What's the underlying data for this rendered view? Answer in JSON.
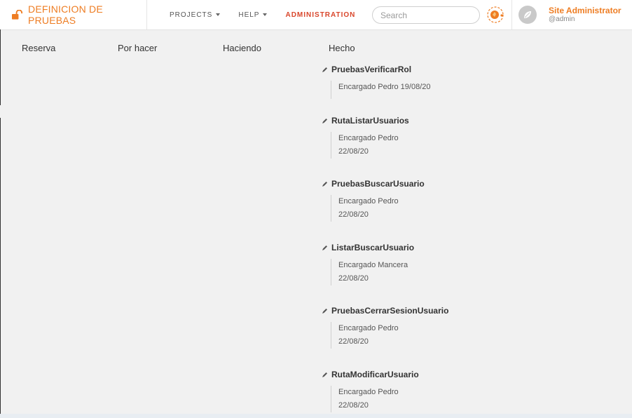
{
  "header": {
    "brand": "DEFINICION DE PRUEBAS",
    "nav": {
      "projects": "PROJECTS",
      "help": "HELP",
      "administration": "ADMINISTRATION"
    },
    "search_placeholder": "Search",
    "user": {
      "name": "Site Administrator",
      "handle": "@admin"
    }
  },
  "columns": [
    "Reserva",
    "Por hacer",
    "Haciendo",
    "Hecho"
  ],
  "cards": [
    {
      "title": "PruebasVerificarRol",
      "assignee": "Encargado Pedro 19/08/20",
      "date": ""
    },
    {
      "title": "RutaListarUsuarios",
      "assignee": "Encargado Pedro",
      "date": "22/08/20"
    },
    {
      "title": "PruebasBuscarUsuario",
      "assignee": "Encargado Pedro",
      "date": "22/08/20"
    },
    {
      "title": "ListarBuscarUsuario",
      "assignee": "Encargado Mancera",
      "date": "22/08/20"
    },
    {
      "title": "PruebasCerrarSesionUsuario",
      "assignee": "Encargado Pedro",
      "date": "22/08/20"
    },
    {
      "title": "RutaModificarUsuario",
      "assignee": "Encargado Pedro",
      "date": "22/08/20"
    }
  ],
  "colors": {
    "brand": "#ee7d23",
    "admin": "#d9462b",
    "background": "#f1f1f1"
  },
  "icons": {
    "brand": "unlock-icon",
    "tools": "tools-icon",
    "avatar": "avatar-icon",
    "edit": "pencil-icon"
  }
}
